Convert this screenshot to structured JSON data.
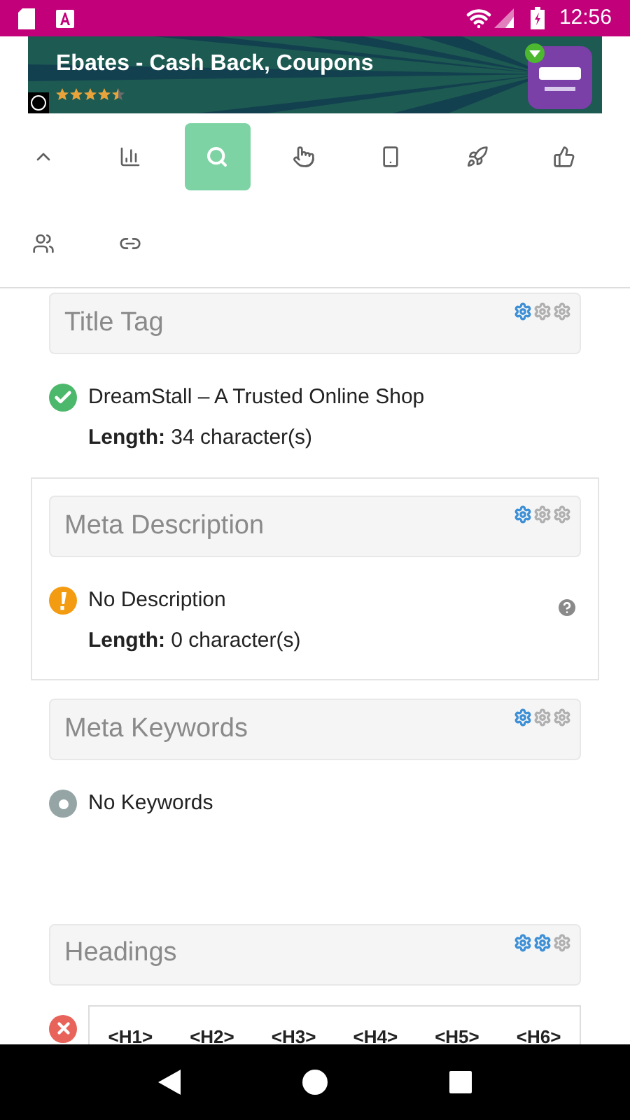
{
  "status_bar": {
    "time": "12:56"
  },
  "ad": {
    "title": "Ebates - Cash Back, Coupons",
    "stars": 4.5
  },
  "toolbar": {
    "items": [
      {
        "selected": false
      },
      {
        "selected": false
      },
      {
        "selected": true
      },
      {
        "selected": false
      },
      {
        "selected": false
      },
      {
        "selected": false
      },
      {
        "selected": false
      },
      {
        "selected": false
      },
      {
        "selected": false
      }
    ]
  },
  "sections": [
    {
      "title": "Title Tag",
      "gears": [
        true,
        false,
        false
      ],
      "highlighted": false,
      "kind": "pass",
      "text": "DreamStall – A Trusted Online Shop",
      "length_label": "Length:",
      "length_value": "34 character(s)",
      "help": false
    },
    {
      "title": "Meta Description",
      "gears": [
        true,
        false,
        false
      ],
      "highlighted": true,
      "kind": "warning",
      "text": "No Description",
      "length_label": "Length:",
      "length_value": "0 character(s)",
      "help": true
    },
    {
      "title": "Meta Keywords",
      "gears": [
        true,
        false,
        false
      ],
      "highlighted": false,
      "kind": "info",
      "text": "No Keywords",
      "help": false
    },
    {
      "title": "Headings",
      "gears": [
        true,
        true,
        false
      ],
      "highlighted": false,
      "kind": "fail",
      "table_columns": [
        "<H1>",
        "<H2>",
        "<H3>",
        "<H4>",
        "<H5>",
        "<H6>"
      ],
      "help": false
    }
  ]
}
